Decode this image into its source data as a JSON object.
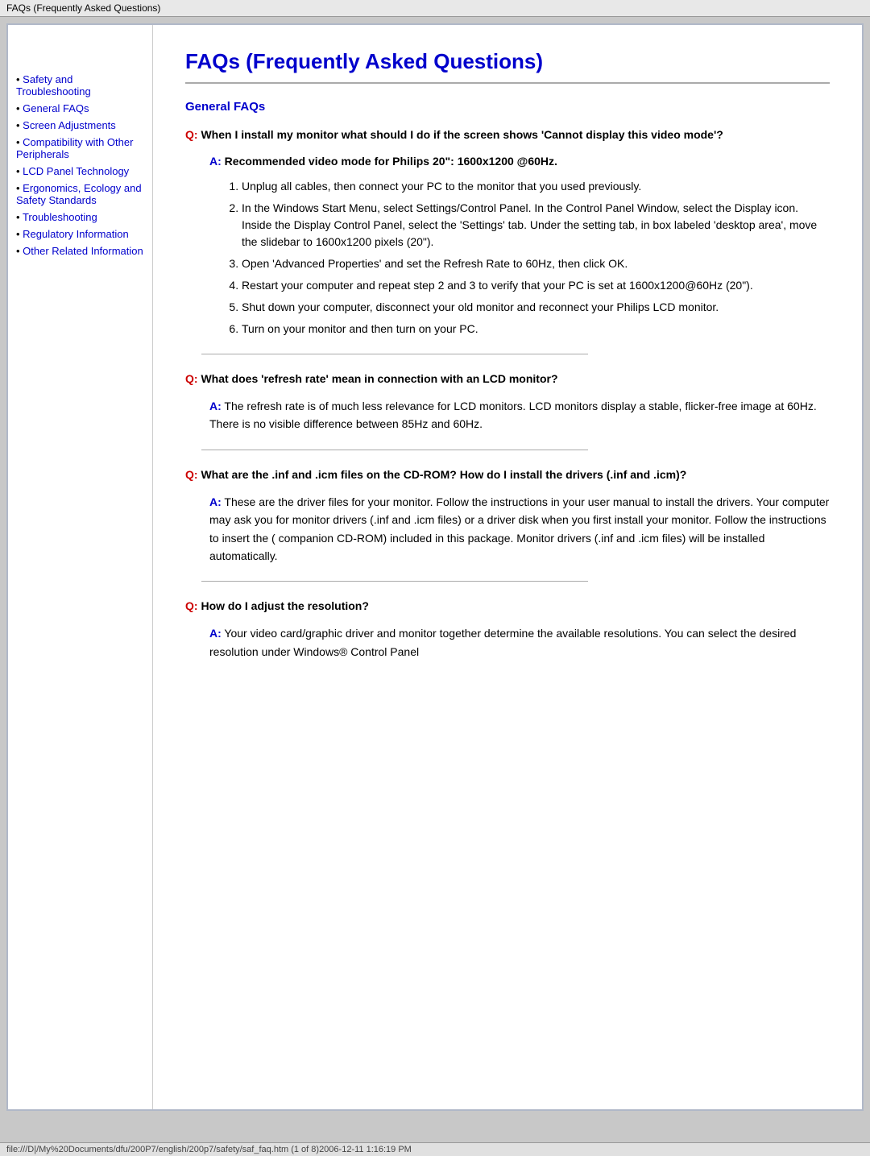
{
  "titleBar": {
    "text": "FAQs (Frequently Asked Questions)"
  },
  "sidebar": {
    "items": [
      {
        "id": "safety",
        "label": "Safety and Troubleshooting",
        "href": "#"
      },
      {
        "id": "general-faqs",
        "label": "General FAQs",
        "href": "#"
      },
      {
        "id": "screen",
        "label": "Screen Adjustments",
        "href": "#"
      },
      {
        "id": "compatibility",
        "label": "Compatibility with Other Peripherals",
        "href": "#"
      },
      {
        "id": "lcd",
        "label": "LCD Panel Technology",
        "href": "#"
      },
      {
        "id": "ergonomics",
        "label": "Ergonomics, Ecology and Safety Standards",
        "href": "#"
      },
      {
        "id": "troubleshooting",
        "label": "Troubleshooting",
        "href": "#"
      },
      {
        "id": "regulatory",
        "label": "Regulatory Information",
        "href": "#"
      },
      {
        "id": "other",
        "label": "Other Related Information",
        "href": "#"
      }
    ]
  },
  "main": {
    "pageTitle": "FAQs (Frequently Asked Questions)",
    "sectionHeading": "General FAQs",
    "q1": {
      "label": "Q:",
      "text": "When I install my monitor what should I do if the screen shows 'Cannot display this video mode'?"
    },
    "a1": {
      "label": "A:",
      "intro": "Recommended video mode for Philips 20\": 1600x1200 @60Hz.",
      "steps": [
        "Unplug all cables, then connect your PC to the monitor that you used previously.",
        "In the Windows Start Menu, select Settings/Control Panel. In the Control Panel Window, select the Display icon. Inside the Display Control Panel, select the 'Settings' tab. Under the setting tab, in box labeled 'desktop area', move the slidebar to 1600x1200 pixels (20\").",
        "Open 'Advanced Properties' and set the Refresh Rate to 60Hz, then click OK.",
        "Restart your computer and repeat step 2 and 3 to verify that your PC is set at 1600x1200@60Hz (20\").",
        "Shut down your computer, disconnect your old monitor and reconnect your Philips LCD monitor.",
        "Turn on your monitor and then turn on your PC."
      ]
    },
    "q2": {
      "label": "Q:",
      "text": "What does 'refresh rate' mean in connection with an LCD monitor?"
    },
    "a2": {
      "label": "A:",
      "text": "The refresh rate is of much less relevance for LCD monitors. LCD monitors display a stable, flicker-free image at 60Hz. There is no visible difference between 85Hz and 60Hz."
    },
    "q3": {
      "label": "Q:",
      "text": "What are the .inf and .icm files on the CD-ROM? How do I install the drivers (.inf and .icm)?"
    },
    "a3": {
      "label": "A:",
      "text": "These are the driver files for your monitor. Follow the instructions in your user manual to install the drivers. Your computer may ask you for monitor drivers (.inf and .icm files) or a driver disk when you first install your monitor. Follow the instructions to insert the ( companion CD-ROM) included in this package. Monitor drivers (.inf and .icm files) will be installed automatically."
    },
    "q4": {
      "label": "Q:",
      "text": "How do I adjust the resolution?"
    },
    "a4": {
      "label": "A:",
      "text": "Your video card/graphic driver and monitor together determine the available resolutions. You can select the desired resolution under Windows® Control Panel"
    }
  },
  "statusBar": {
    "text": "file:///D|/My%20Documents/dfu/200P7/english/200p7/safety/saf_faq.htm (1 of 8)2006-12-11 1:16:19 PM"
  }
}
